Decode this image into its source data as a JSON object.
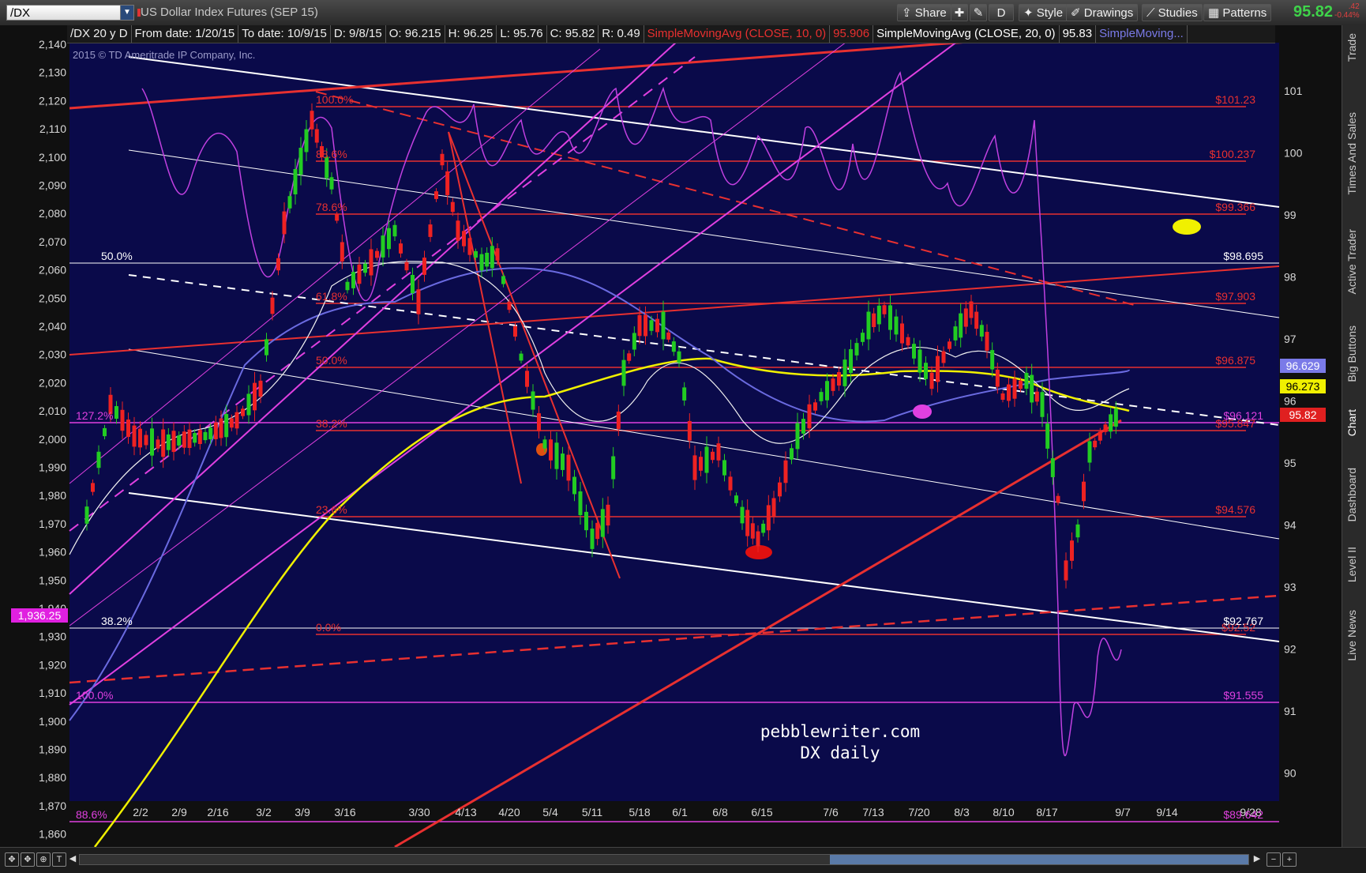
{
  "toolbar": {
    "symbol": "/DX",
    "description": "US Dollar Index Futures (SEP 15)",
    "share": "Share",
    "style": "Style",
    "drawings": "Drawings",
    "studies": "Studies",
    "patterns": "Patterns",
    "d_label": "D",
    "last_price": "95.82",
    "change": ".42",
    "change_pct": "-0.44%"
  },
  "infobar": {
    "period": "/DX 20 y D",
    "from": "From date: 1/20/15",
    "to": "To date: 10/9/15",
    "date": "D: 9/8/15",
    "open": "O: 96.215",
    "high": "H: 96.25",
    "low": "L: 95.76",
    "close": "C: 95.82",
    "range": "R: 0.49",
    "sma10": "SimpleMovingAvg (CLOSE, 10, 0)",
    "sma10_val": "95.906",
    "sma20": "SimpleMovingAvg (CLOSE, 20, 0)",
    "sma20_val": "95.83",
    "sma_more": "SimpleMoving..."
  },
  "chart": {
    "copyright": "2015 © TD Ameritrade IP Company, Inc.",
    "watermark1": "pebblewriter.com",
    "watermark2": "DX daily",
    "left_axis": [
      "2,140",
      "2,130",
      "2,120",
      "2,110",
      "2,100",
      "2,090",
      "2,080",
      "2,070",
      "2,060",
      "2,050",
      "2,040",
      "2,030",
      "2,020",
      "2,010",
      "2,000",
      "1,990",
      "1,980",
      "1,970",
      "1,960",
      "1,950",
      "1,940",
      "1,930",
      "1,920",
      "1,910",
      "1,900",
      "1,890",
      "1,880",
      "1,870",
      "1,860"
    ],
    "right_axis": [
      "101",
      "100",
      "99",
      "98",
      "97",
      "96",
      "95",
      "94",
      "93",
      "92",
      "91",
      "90"
    ],
    "x_axis": [
      "2/2",
      "2/9",
      "2/16",
      "3/2",
      "3/9",
      "3/16",
      "3/30",
      "4/13",
      "4/20",
      "5/4",
      "5/11",
      "5/18",
      "6/1",
      "6/8",
      "6/15",
      "7/6",
      "7/13",
      "7/20",
      "8/3",
      "8/10",
      "8/17",
      "9/7",
      "9/14",
      "9/28"
    ],
    "left_tag": "1,936.25",
    "price_tags": {
      "p1": "96.629",
      "p2": "96.273",
      "p3": "95.82"
    },
    "fib_red": [
      {
        "pct": "100.0%",
        "price": "$101.23"
      },
      {
        "pct": "88.6%",
        "price": "$100.237"
      },
      {
        "pct": "78.6%",
        "price": "$99.366"
      },
      {
        "pct": "61.8%",
        "price": "$97.903"
      },
      {
        "pct": "50.0%",
        "price": "$96.875"
      },
      {
        "pct": "38.2%",
        "price": "$95.847"
      },
      {
        "pct": "23.6%",
        "price": "$94.576"
      },
      {
        "pct": "0.0%",
        "price": "$92.52"
      }
    ],
    "fib_white": [
      {
        "pct": "50.0%",
        "price": "$98.695"
      },
      {
        "pct": "38.2%",
        "price": "$92.767"
      }
    ],
    "fib_magenta": [
      {
        "pct": "127.2%",
        "price": "$96.121"
      },
      {
        "pct": "100.0%",
        "price": "$91.555"
      },
      {
        "pct": "88.6%",
        "price": "$89.642"
      }
    ]
  },
  "sidebar": [
    "Trade",
    "Times And Sales",
    "Active Trader",
    "Big Buttons",
    "Chart",
    "Dashboard",
    "Level II",
    "Live News"
  ],
  "colors": {
    "background": "#0a0a4a",
    "up": "#22cc22",
    "down": "#ee2222",
    "fib_red": "#e83030",
    "magenta": "#e040e0",
    "yellow": "#f0f000",
    "blue": "#6a6ae0",
    "white": "#ffffff"
  }
}
